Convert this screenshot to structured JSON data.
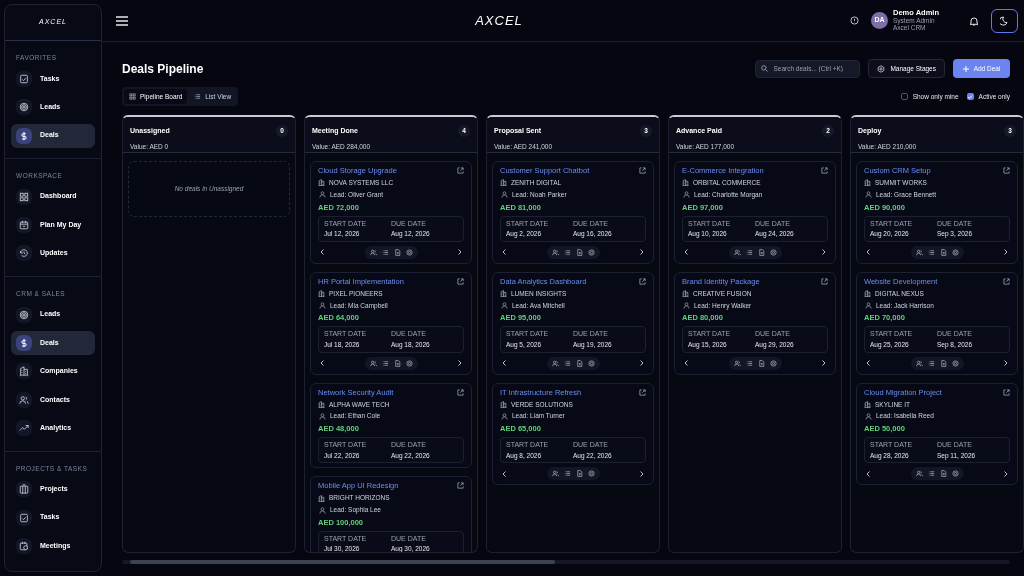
{
  "sidebar": {
    "logo": "AXCEL",
    "sections": [
      {
        "title": "FAVORITES",
        "items": [
          {
            "label": "Tasks",
            "kind": "task",
            "selected": false
          },
          {
            "label": "Leads",
            "kind": "target",
            "selected": false
          },
          {
            "label": "Deals",
            "kind": "dollar",
            "selected": true
          }
        ]
      },
      {
        "title": "WORKSPACE",
        "items": [
          {
            "label": "Dashboard",
            "kind": "grid",
            "selected": false
          },
          {
            "label": "Plan My Day",
            "kind": "calendar",
            "selected": false
          },
          {
            "label": "Updates",
            "kind": "history",
            "selected": false
          }
        ]
      },
      {
        "title": "CRM & SALES",
        "items": [
          {
            "label": "Leads",
            "kind": "target",
            "selected": false
          },
          {
            "label": "Deals",
            "kind": "dollar",
            "selected": true
          },
          {
            "label": "Companies",
            "kind": "building",
            "selected": false
          },
          {
            "label": "Contacts",
            "kind": "users",
            "selected": false
          },
          {
            "label": "Analytics",
            "kind": "trend",
            "selected": false
          }
        ]
      },
      {
        "title": "PROJECTS & TASKS",
        "items": [
          {
            "label": "Projects",
            "kind": "folder",
            "selected": false
          },
          {
            "label": "Tasks",
            "kind": "task",
            "selected": false
          },
          {
            "label": "Meetings",
            "kind": "meeting",
            "selected": false
          }
        ]
      }
    ]
  },
  "header": {
    "logo": "AXCEL",
    "user": {
      "initials": "DA",
      "name": "Demo Admin",
      "role": "System Admin",
      "org": "Axcel CRM"
    }
  },
  "page": {
    "title": "Deals Pipeline",
    "view_tabs": [
      {
        "label": "Pipeline Board",
        "kind": "grid",
        "selected": true
      },
      {
        "label": "List View",
        "kind": "list",
        "selected": false
      }
    ],
    "search": {
      "placeholder": "Search deals... (Ctrl +K)"
    },
    "manage_button": "Manage Stages",
    "add_button": "Add Deal",
    "filters": [
      {
        "label": "Show only mine",
        "checked": false
      },
      {
        "label": "Active only",
        "checked": true
      }
    ]
  },
  "columns": [
    {
      "name": "Unassigned",
      "count": "0",
      "value": "Value: AED 0",
      "empty_text": "No deals in Unassigned"
    },
    {
      "name": "Meeting Done",
      "count": "4",
      "value": "Value: AED 284,000",
      "deals": [
        {
          "title": "Cloud Storage Upgrade",
          "company": "NOVA SYSTEMS LLC",
          "lead": "Lead: Oliver Grant",
          "amount": "AED 72,000",
          "start_label": "START DATE",
          "start": "Jul 12, 2026",
          "due_label": "DUE DATE",
          "due": "Aug 12, 2026",
          "nav": true
        },
        {
          "title": "HR Portal Implementation",
          "company": "PIXEL PIONEERS",
          "lead": "Lead: Mia Campbell",
          "amount": "AED 64,000",
          "start_label": "START DATE",
          "start": "Jul 18, 2026",
          "due_label": "DUE DATE",
          "due": "Aug 18, 2026",
          "nav": true
        },
        {
          "title": "Network Security Audit",
          "company": "ALPHA WAVE TECH",
          "lead": "Lead: Ethan Cole",
          "amount": "AED 48,000",
          "start_label": "START DATE",
          "start": "Jul 22, 2026",
          "due_label": "DUE DATE",
          "due": "Aug 22, 2026",
          "nav": false
        },
        {
          "title": "Mobile App UI Redesign",
          "company": "BRIGHT HORIZONS",
          "lead": "Lead: Sophia Lee",
          "amount": "AED 100,000",
          "start_label": "START DATE",
          "start": "Jul 30, 2026",
          "due_label": "DUE DATE",
          "due": "Aug 30, 2026",
          "nav": false
        }
      ]
    },
    {
      "name": "Proposal Sent",
      "count": "3",
      "value": "Value: AED 241,000",
      "deals": [
        {
          "title": "Customer Support Chatbot",
          "company": "ZENITH DIGITAL",
          "lead": "Lead: Noah Parker",
          "amount": "AED 81,000",
          "start_label": "START DATE",
          "start": "Aug 2, 2026",
          "due_label": "DUE DATE",
          "due": "Aug 16, 2026",
          "nav": true
        },
        {
          "title": "Data Analytics Dashboard",
          "company": "LUMEN INSIGHTS",
          "lead": "Lead: Ava Mitchell",
          "amount": "AED 95,000",
          "start_label": "START DATE",
          "start": "Aug 5, 2026",
          "due_label": "DUE DATE",
          "due": "Aug 19, 2026",
          "nav": true
        },
        {
          "title": "IT Infrastructure Refresh",
          "company": "VERDE SOLUTIONS",
          "lead": "Lead: Liam Turner",
          "amount": "AED 65,000",
          "start_label": "START DATE",
          "start": "Aug 8, 2026",
          "due_label": "DUE DATE",
          "due": "Aug 22, 2026",
          "nav": true
        }
      ]
    },
    {
      "name": "Advance Paid",
      "count": "2",
      "value": "Value: AED 177,000",
      "deals": [
        {
          "title": "E-Commerce Integration",
          "company": "ORBITAL COMMERCE",
          "lead": "Lead: Charlotte Morgan",
          "amount": "AED 97,000",
          "start_label": "START DATE",
          "start": "Aug 10, 2026",
          "due_label": "DUE DATE",
          "due": "Aug 24, 2026",
          "nav": true
        },
        {
          "title": "Brand Identity Package",
          "company": "CREATIVE FUSION",
          "lead": "Lead: Henry Walker",
          "amount": "AED 80,000",
          "start_label": "START DATE",
          "start": "Aug 15, 2026",
          "due_label": "DUE DATE",
          "due": "Aug 29, 2026",
          "nav": true
        }
      ]
    },
    {
      "name": "Deploy",
      "count": "3",
      "value": "Value: AED 210,000",
      "deals": [
        {
          "title": "Custom CRM Setup",
          "company": "SUMMIT WORKS",
          "lead": "Lead: Grace Bennett",
          "amount": "AED 90,000",
          "start_label": "START DATE",
          "start": "Aug 20, 2026",
          "due_label": "DUE DATE",
          "due": "Sep 3, 2026",
          "nav": true
        },
        {
          "title": "Website Development",
          "company": "DIGITAL NEXUS",
          "lead": "Lead: Jack Harrison",
          "amount": "AED 70,000",
          "start_label": "START DATE",
          "start": "Aug 25, 2026",
          "due_label": "DUE DATE",
          "due": "Sep 8, 2026",
          "nav": true
        },
        {
          "title": "Cloud Migration Project",
          "company": "SKYLINE IT",
          "lead": "Lead: Isabella Reed",
          "amount": "AED 50,000",
          "start_label": "START DATE",
          "start": "Aug 28, 2026",
          "due_label": "DUE DATE",
          "due": "Sep 11, 2026",
          "nav": true
        }
      ]
    }
  ]
}
